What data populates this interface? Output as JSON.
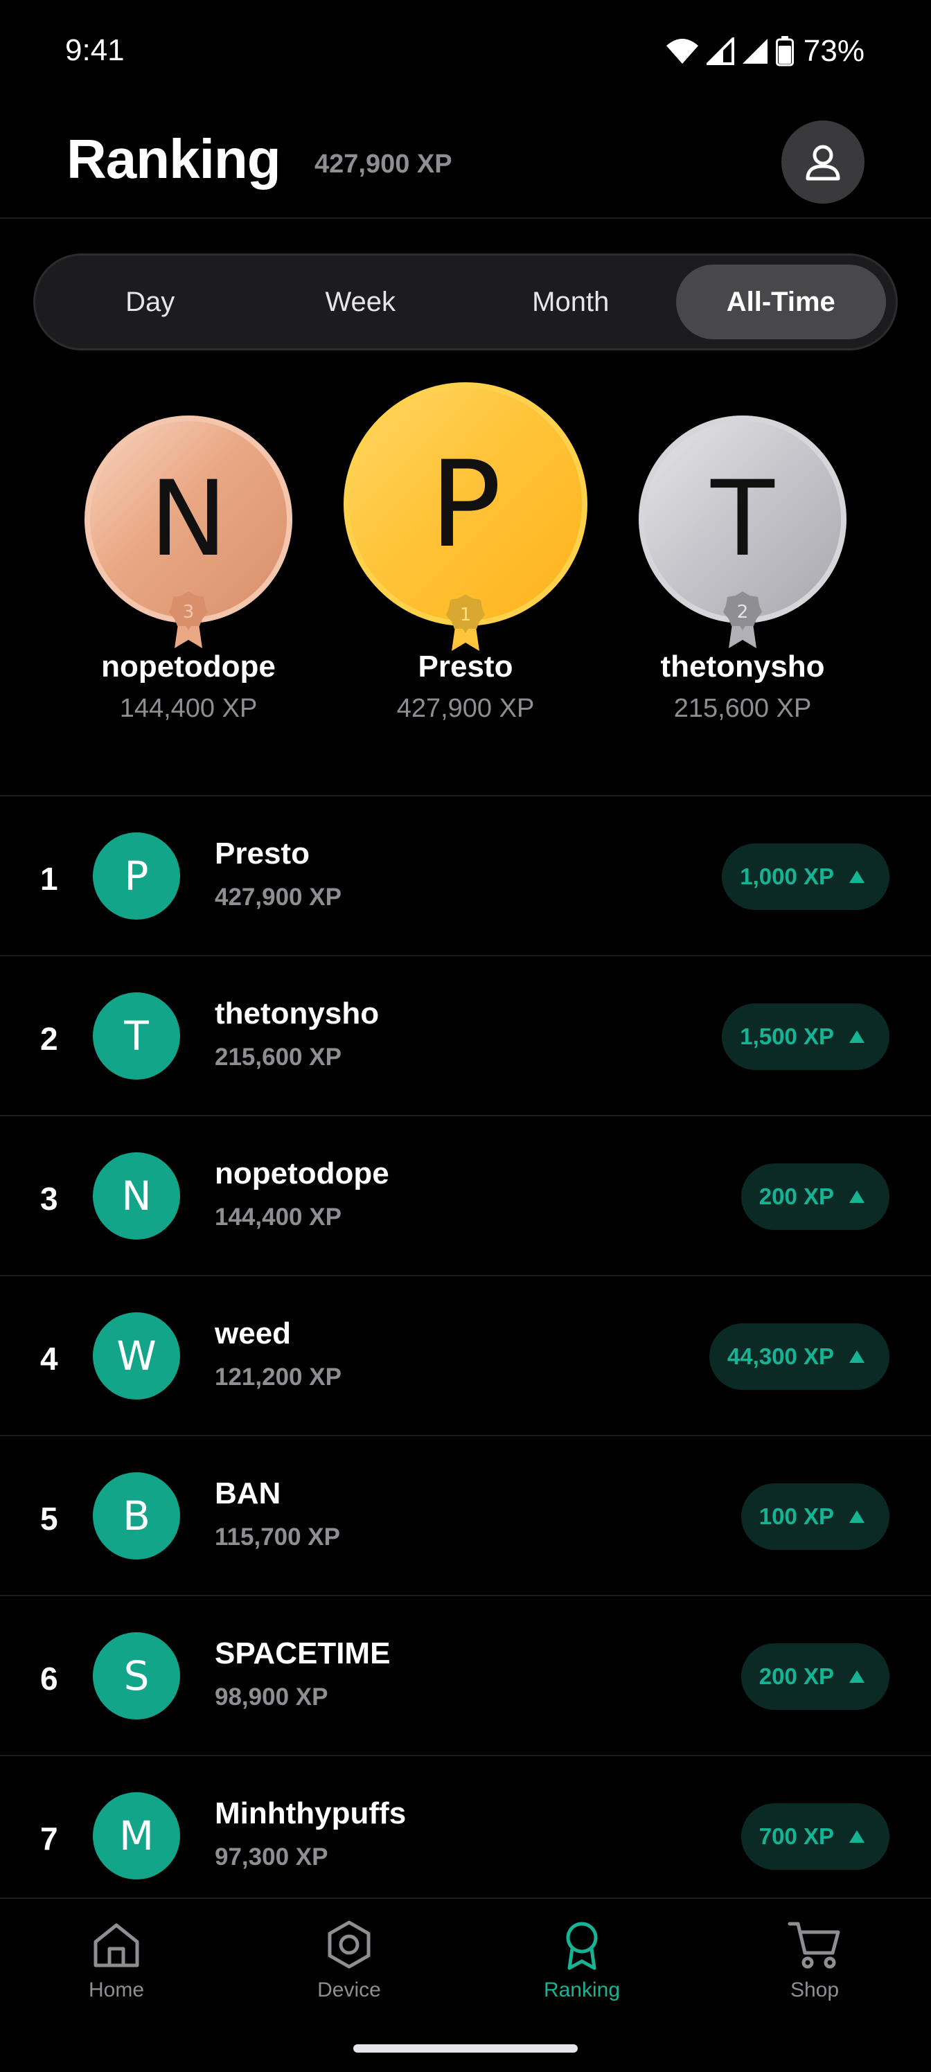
{
  "status_bar": {
    "time": "9:41",
    "battery": "73%"
  },
  "header": {
    "title": "Ranking",
    "xp": "427,900 XP",
    "profile_icon": "user-icon"
  },
  "tabs": [
    {
      "label": "Day",
      "active": false
    },
    {
      "label": "Week",
      "active": false
    },
    {
      "label": "Month",
      "active": false
    },
    {
      "label": "All-Time",
      "active": true
    }
  ],
  "podium": {
    "third": {
      "initial": "N",
      "rank": "3",
      "name": "nopetodope",
      "xp": "144,400 XP",
      "color": "#e9a784"
    },
    "first": {
      "initial": "P",
      "rank": "1",
      "name": "Presto",
      "xp": "427,900 XP",
      "color": "#ffc53d"
    },
    "second": {
      "initial": "T",
      "rank": "2",
      "name": "thetonysho",
      "xp": "215,600 XP",
      "color": "#c4c4ca"
    }
  },
  "leaderboard": [
    {
      "rank": "1",
      "initial": "P",
      "name": "Presto",
      "xp": "427,900 XP",
      "gain": "1,000 XP"
    },
    {
      "rank": "2",
      "initial": "T",
      "name": "thetonysho",
      "xp": "215,600 XP",
      "gain": "1,500 XP"
    },
    {
      "rank": "3",
      "initial": "N",
      "name": "nopetodope",
      "xp": "144,400 XP",
      "gain": "200 XP"
    },
    {
      "rank": "4",
      "initial": "W",
      "name": "weed",
      "xp": "121,200 XP",
      "gain": "44,300 XP"
    },
    {
      "rank": "5",
      "initial": "B",
      "name": "BAN",
      "xp": "115,700 XP",
      "gain": "100 XP"
    },
    {
      "rank": "6",
      "initial": "S",
      "name": "SPACETIME",
      "xp": "98,900 XP",
      "gain": "200 XP"
    },
    {
      "rank": "7",
      "initial": "M",
      "name": "Minhthypuffs",
      "xp": "97,300 XP",
      "gain": "700 XP"
    }
  ],
  "nav": [
    {
      "label": "Home",
      "icon": "home-icon",
      "active": false
    },
    {
      "label": "Device",
      "icon": "hexagon-icon",
      "active": false
    },
    {
      "label": "Ranking",
      "icon": "ribbon-icon",
      "active": true
    },
    {
      "label": "Shop",
      "icon": "cart-icon",
      "active": false
    }
  ],
  "colors": {
    "accent": "#16b394",
    "avatar": "#12a58a",
    "background": "#000000"
  }
}
